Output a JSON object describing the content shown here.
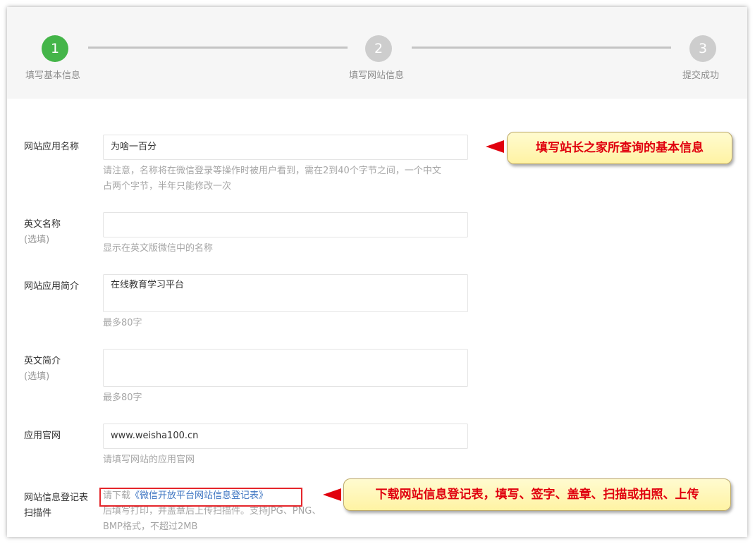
{
  "steps": [
    {
      "number": "1",
      "label": "填写基本信息"
    },
    {
      "number": "2",
      "label": "填写网站信息"
    },
    {
      "number": "3",
      "label": "提交成功"
    }
  ],
  "form": {
    "app_name": {
      "label": "网站应用名称",
      "value": "为啥一百分",
      "hint_line1": "请注意，名称将在微信登录等操作时被用户看到，需在2到40个字节之间，一个中文",
      "hint_line2": "占两个字节，半年只能修改一次"
    },
    "english_name": {
      "label": "英文名称",
      "optional": "(选填)",
      "value": "",
      "hint": "显示在英文版微信中的名称"
    },
    "app_intro": {
      "label": "网站应用简介",
      "value": "在线教育学习平台",
      "hint": "最多80字"
    },
    "english_intro": {
      "label": "英文简介",
      "optional": "(选填)",
      "value": "",
      "hint": "最多80字"
    },
    "website": {
      "label": "应用官网",
      "value": "www.weisha100.cn",
      "hint": "请填写网站的应用官网"
    },
    "registration": {
      "label_line1": "网站信息登记表",
      "label_line2": "扫描件",
      "hint_prefix": "请下载",
      "download_link": "《微信开放平台网站信息登记表》",
      "hint_line2": "后填写打印，并盖章后上传扫描件。支持JPG、PNG、",
      "hint_line3": "BMP格式，不超过2MB"
    }
  },
  "annotations": {
    "callout1": "填写站长之家所查询的基本信息",
    "callout2": "下载网站信息登记表，填写、签字、盖章、扫描或拍照、上传"
  },
  "colors": {
    "active_step": "#44b549",
    "inactive_step": "#cdcdcd",
    "link": "#3e75c2",
    "annotation_text": "#e0000e"
  }
}
